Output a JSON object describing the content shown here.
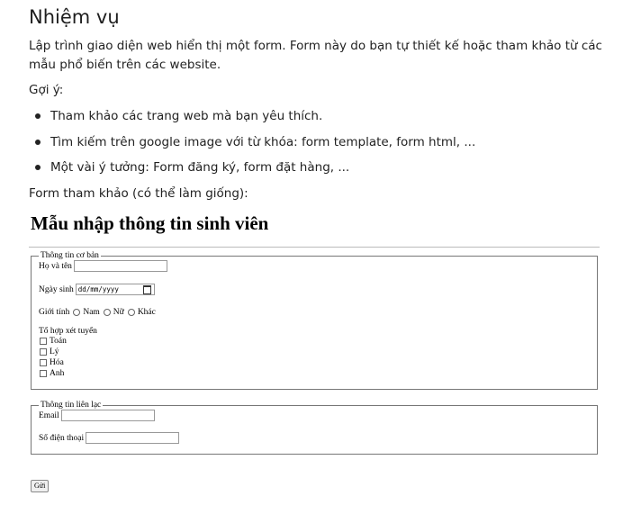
{
  "task": {
    "title": "Nhiệm vụ",
    "intro": "Lập trình giao diện web hiển thị một form. Form này do bạn tự thiết kế hoặc tham khảo từ các mẫu phổ biến trên các website.",
    "hint_label": "Gợi ý:",
    "hints": [
      "Tham khảo các trang web mà bạn yêu thích.",
      "Tìm kiếm trên google image với từ khóa: form template, form html, ...",
      "Một vài ý tưởng: Form đăng ký, form đặt hàng, ..."
    ],
    "ref_label": "Form tham khảo (có thể làm giống):"
  },
  "form": {
    "title": "Mẫu nhập thông tin sinh viên",
    "basic": {
      "legend": "Thông tin cơ bản",
      "name_label": "Họ và tên",
      "name_value": "",
      "dob_label": "Ngày sinh",
      "dob_placeholder": "dd/mm/yyyy",
      "gender_label": "Giới tính",
      "gender_options": [
        "Nam",
        "Nữ",
        "Khác"
      ],
      "combo_label": "Tổ hợp xét tuyển",
      "combo_options": [
        "Toán",
        "Lý",
        "Hóa",
        "Anh"
      ]
    },
    "contact": {
      "legend": "Thông tin liên lạc",
      "email_label": "Email",
      "email_value": "",
      "phone_label": "Số điện thoại",
      "phone_value": ""
    },
    "submit_label": "Gửi"
  }
}
